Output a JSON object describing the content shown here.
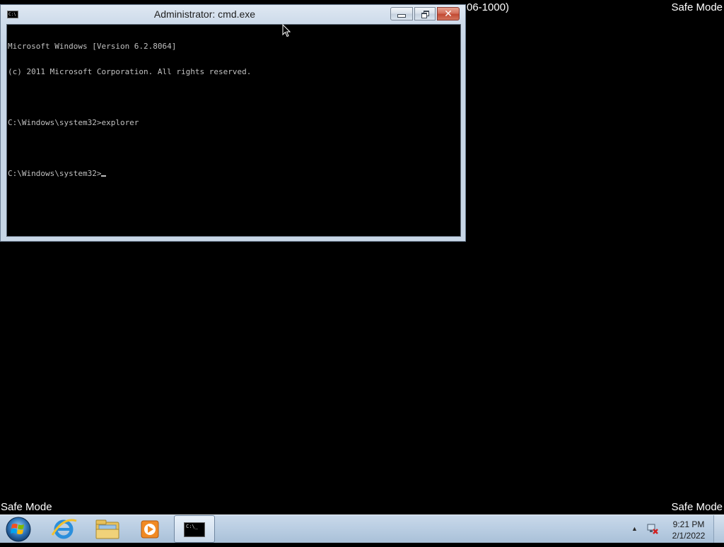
{
  "desktop": {
    "safe_mode_top_right": "Safe Mode",
    "build_fragment": "06-1000)",
    "safe_mode_bottom_left": "Safe Mode",
    "safe_mode_bottom_right": "Safe Mode"
  },
  "window": {
    "title": "Administrator: cmd.exe",
    "icon_text": "C:\\",
    "console_lines": [
      "Microsoft Windows [Version 6.2.8064]",
      "(c) 2011 Microsoft Corporation. All rights reserved.",
      "",
      "C:\\Windows\\system32>explorer",
      "",
      "C:\\Windows\\system32>"
    ]
  },
  "taskbar": {
    "cmd_icon_text": "C:\\_",
    "clock_time": "9:21 PM",
    "clock_date": "2/1/2022",
    "tray_arrow": "▲"
  },
  "colors": {
    "desktop": "#000000",
    "taskbar": "#b9cde2",
    "close_button": "#c94d36"
  }
}
